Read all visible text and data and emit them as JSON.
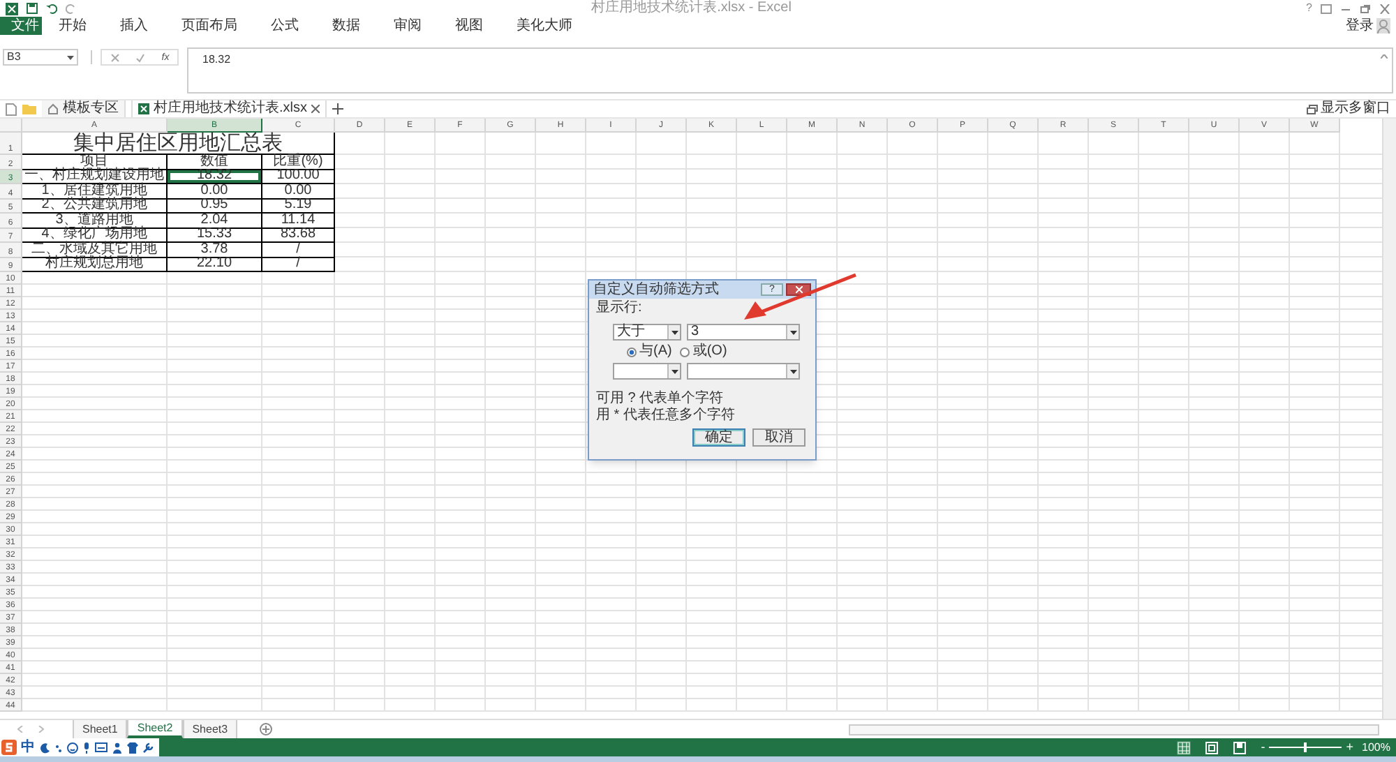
{
  "window": {
    "title": "村庄用地技术统计表.xlsx - Excel",
    "help": "?",
    "sign_in": "登录"
  },
  "ribbon_tabs": [
    {
      "label": "文件",
      "kind": "file"
    },
    {
      "label": "开始",
      "kind": "tab"
    },
    {
      "label": "插入",
      "kind": "tab"
    },
    {
      "label": "页面布局",
      "kind": "tab"
    },
    {
      "label": "公式",
      "kind": "tab"
    },
    {
      "label": "数据",
      "kind": "tab"
    },
    {
      "label": "审阅",
      "kind": "tab"
    },
    {
      "label": "视图",
      "kind": "tab"
    },
    {
      "label": "美化大师",
      "kind": "tab"
    }
  ],
  "formula_bar": {
    "name_box": "B3",
    "fx": "fx",
    "value": "18.32"
  },
  "doc_tabs": [
    {
      "label": "模板专区",
      "kind": "home",
      "selected": false
    },
    {
      "label": "村庄用地技术统计表.xlsx",
      "kind": "workbook",
      "selected": true
    }
  ],
  "multi_window": "显示多窗口",
  "columns": [
    {
      "label": "A",
      "selected": false
    },
    {
      "label": "B",
      "selected": true
    },
    {
      "label": "C",
      "selected": false
    },
    {
      "label": "D",
      "selected": false
    },
    {
      "label": "E",
      "selected": false
    },
    {
      "label": "F",
      "selected": false
    },
    {
      "label": "G",
      "selected": false
    },
    {
      "label": "H",
      "selected": false
    },
    {
      "label": "I",
      "selected": false
    },
    {
      "label": "J",
      "selected": false
    },
    {
      "label": "K",
      "selected": false
    },
    {
      "label": "L",
      "selected": false
    },
    {
      "label": "M",
      "selected": false
    },
    {
      "label": "N",
      "selected": false
    },
    {
      "label": "O",
      "selected": false
    },
    {
      "label": "P",
      "selected": false
    },
    {
      "label": "Q",
      "selected": false
    },
    {
      "label": "R",
      "selected": false
    },
    {
      "label": "S",
      "selected": false
    },
    {
      "label": "T",
      "selected": false
    },
    {
      "label": "U",
      "selected": false
    },
    {
      "label": "V",
      "selected": false
    },
    {
      "label": "W",
      "selected": false
    }
  ],
  "rows": [
    {
      "number": "1",
      "kind": "title",
      "selected": false,
      "cells": [
        {
          "text": "集中居住区用地汇总表",
          "selected": false
        }
      ]
    },
    {
      "number": "2",
      "kind": "data",
      "selected": false,
      "cells": [
        {
          "text": "项目",
          "selected": false
        },
        {
          "text": "数值",
          "selected": false
        },
        {
          "text": "比重(%)",
          "selected": false
        }
      ]
    },
    {
      "number": "3",
      "kind": "data",
      "selected": true,
      "cells": [
        {
          "text": "一、村庄规划建设用地",
          "selected": false
        },
        {
          "text": "18.32",
          "selected": true
        },
        {
          "text": "100.00",
          "selected": false
        }
      ]
    },
    {
      "number": "4",
      "kind": "data",
      "selected": false,
      "cells": [
        {
          "text": "1、居住建筑用地",
          "selected": false
        },
        {
          "text": "0.00",
          "selected": false
        },
        {
          "text": "0.00",
          "selected": false
        }
      ]
    },
    {
      "number": "5",
      "kind": "data",
      "selected": false,
      "cells": [
        {
          "text": "2、公共建筑用地",
          "selected": false
        },
        {
          "text": "0.95",
          "selected": false
        },
        {
          "text": "5.19",
          "selected": false
        }
      ]
    },
    {
      "number": "6",
      "kind": "data",
      "selected": false,
      "cells": [
        {
          "text": "3、道路用地",
          "selected": false
        },
        {
          "text": "2.04",
          "selected": false
        },
        {
          "text": "11.14",
          "selected": false
        }
      ]
    },
    {
      "number": "7",
      "kind": "data",
      "selected": false,
      "cells": [
        {
          "text": "4、绿化广场用地",
          "selected": false
        },
        {
          "text": "15.33",
          "selected": false
        },
        {
          "text": "83.68",
          "selected": false
        }
      ]
    },
    {
      "number": "8",
      "kind": "data",
      "selected": false,
      "cells": [
        {
          "text": "二、水域及其它用地",
          "selected": false
        },
        {
          "text": "3.78",
          "selected": false
        },
        {
          "text": "/",
          "selected": false
        }
      ]
    },
    {
      "number": "9",
      "kind": "data",
      "selected": false,
      "cells": [
        {
          "text": "村庄规划总用地",
          "selected": false
        },
        {
          "text": "22.10",
          "selected": false
        },
        {
          "text": "/",
          "selected": false
        }
      ]
    },
    {
      "number": "10",
      "kind": "empty",
      "selected": false
    },
    {
      "number": "11",
      "kind": "empty",
      "selected": false
    },
    {
      "number": "12",
      "kind": "empty",
      "selected": false
    },
    {
      "number": "13",
      "kind": "empty",
      "selected": false
    },
    {
      "number": "14",
      "kind": "empty",
      "selected": false
    },
    {
      "number": "15",
      "kind": "empty",
      "selected": false
    },
    {
      "number": "16",
      "kind": "empty",
      "selected": false
    },
    {
      "number": "17",
      "kind": "empty",
      "selected": false
    },
    {
      "number": "18",
      "kind": "empty",
      "selected": false
    },
    {
      "number": "19",
      "kind": "empty",
      "selected": false
    },
    {
      "number": "20",
      "kind": "empty",
      "selected": false
    },
    {
      "number": "21",
      "kind": "empty",
      "selected": false
    },
    {
      "number": "22",
      "kind": "empty",
      "selected": false
    },
    {
      "number": "23",
      "kind": "empty",
      "selected": false
    },
    {
      "number": "24",
      "kind": "empty",
      "selected": false
    },
    {
      "number": "25",
      "kind": "empty",
      "selected": false
    },
    {
      "number": "26",
      "kind": "empty",
      "selected": false
    },
    {
      "number": "27",
      "kind": "empty",
      "selected": false
    },
    {
      "number": "28",
      "kind": "empty",
      "selected": false
    },
    {
      "number": "29",
      "kind": "empty",
      "selected": false
    },
    {
      "number": "30",
      "kind": "empty",
      "selected": false
    },
    {
      "number": "31",
      "kind": "empty",
      "selected": false
    },
    {
      "number": "32",
      "kind": "empty",
      "selected": false
    },
    {
      "number": "33",
      "kind": "empty",
      "selected": false
    },
    {
      "number": "34",
      "kind": "empty",
      "selected": false
    },
    {
      "number": "35",
      "kind": "empty",
      "selected": false
    },
    {
      "number": "36",
      "kind": "empty",
      "selected": false
    },
    {
      "number": "37",
      "kind": "empty",
      "selected": false
    },
    {
      "number": "38",
      "kind": "empty",
      "selected": false
    },
    {
      "number": "39",
      "kind": "empty",
      "selected": false
    },
    {
      "number": "40",
      "kind": "empty",
      "selected": false
    },
    {
      "number": "41",
      "kind": "empty",
      "selected": false
    },
    {
      "number": "42",
      "kind": "empty",
      "selected": false
    },
    {
      "number": "43",
      "kind": "empty",
      "selected": false
    },
    {
      "number": "44",
      "kind": "empty",
      "selected": false
    }
  ],
  "dialog": {
    "title": "自定义自动筛选方式",
    "help": "?",
    "label": "显示行:",
    "condition1": {
      "operator": "大于",
      "value": "3"
    },
    "logic": [
      {
        "label": "与(A)",
        "selected": true
      },
      {
        "label": "或(O)",
        "selected": false
      }
    ],
    "hints": [
      "可用 ? 代表单个字符",
      "用 * 代表任意多个字符"
    ],
    "buttons": [
      {
        "label": "确定",
        "default": true
      },
      {
        "label": "取消",
        "default": false
      }
    ]
  },
  "sheet_tabs": [
    {
      "label": "Sheet1",
      "selected": false
    },
    {
      "label": "Sheet2",
      "selected": true
    },
    {
      "label": "Sheet3",
      "selected": false
    }
  ],
  "ime": {
    "label": "中"
  },
  "status_bar": {
    "views": [
      {
        "kind": "normal",
        "selected": true
      },
      {
        "kind": "page_layout",
        "selected": false
      },
      {
        "kind": "page_break",
        "selected": false
      }
    ],
    "zoom": {
      "level": 0.5,
      "label": "100%",
      "minus": "-",
      "plus": "+"
    }
  }
}
